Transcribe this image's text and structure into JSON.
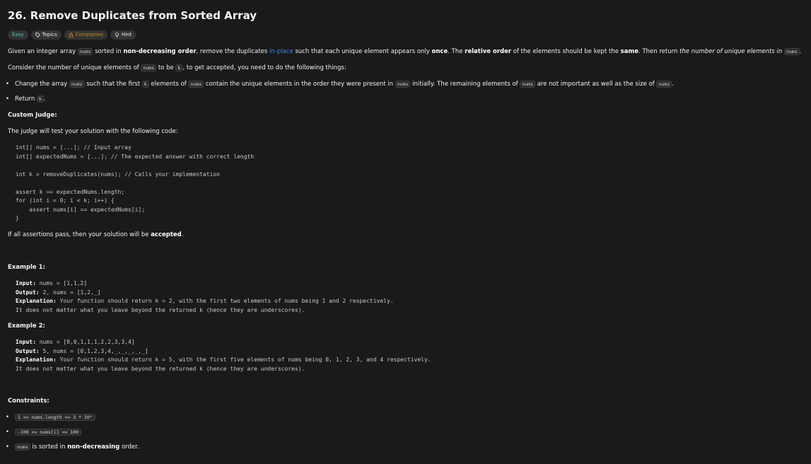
{
  "problem": {
    "title": "26. Remove Duplicates from Sorted Array",
    "tags": {
      "difficulty": "Easy",
      "topics": "Topics",
      "companies": "Companies",
      "hint": "Hint"
    }
  },
  "description": {
    "p1_a": "Given an integer array",
    "code_nums": "nums",
    "p1_b": "sorted in",
    "p1_c": "non-decreasing order",
    "p1_d": ", remove the duplicates",
    "p1_e": "in-place",
    "p1_f": "such that each unique element appears only",
    "p1_g": "once",
    "p1_h": ". The",
    "p1_i": "relative order",
    "p1_j": "of the elements should be kept the",
    "p1_k": "same",
    "p1_l": ". Then return",
    "p1_m": "the number of unique elements in",
    "p1_n": ".",
    "p2_a": "Consider the number of unique elements of",
    "p2_b": "to be",
    "code_k": "k",
    "p2_c": ", to get accepted, you need to do the following things:",
    "b1_a": "Change the array",
    "b1_b": "such that the first",
    "b1_c": "elements of",
    "b1_d": "contain the unique elements in the order they were present in",
    "b1_e": "initially. The remaining elements of",
    "b1_f": "are not important as well as the size of",
    "b1_g": ".",
    "b2_a": "Return",
    "b2_b": ".",
    "custom_judge": "Custom Judge:",
    "judge_intro": "The judge will test your solution with the following code:",
    "judge_code": [
      "int[] nums = [...]; // Input array",
      "int[] expectedNums = [...]; // The expected answer with correct length",
      "",
      "int k = removeDuplicates(nums); // Calls your implementation",
      "",
      "assert k == expectedNums.length;",
      "for (int i = 0; i < k; i++) {",
      "    assert nums[i] == expectedNums[i];",
      "}"
    ],
    "accepted_a": "If all assertions pass, then your solution will be",
    "accepted_b": "accepted",
    "accepted_c": "."
  },
  "examples": [
    {
      "heading": "Example 1:",
      "input_label": "Input:",
      "input": "nums = [1,1,2]",
      "output_label": "Output:",
      "output": "2, nums = [1,2,_]",
      "explanation_label": "Explanation:",
      "explanation_1": "Your function should return k = 2, with the first two elements of nums being 1 and 2 respectively.",
      "explanation_2": "It does not matter what you leave beyond the returned k (hence they are underscores)."
    },
    {
      "heading": "Example 2:",
      "input_label": "Input:",
      "input": "nums = [0,0,1,1,1,2,2,3,3,4]",
      "output_label": "Output:",
      "output": "5, nums = [0,1,2,3,4,_,_,_,_,_]",
      "explanation_label": "Explanation:",
      "explanation_1": "Your function should return k = 5, with the first five elements of nums being 0, 1, 2, 3, and 4 respectively.",
      "explanation_2": "It does not matter what you leave beyond the returned k (hence they are underscores)."
    }
  ],
  "constraints": {
    "heading": "Constraints:",
    "c1": "1 <= nums.length <= 3 * 10⁴",
    "c2": "-100 <= nums[i] <= 100",
    "c3_code": "nums",
    "c3_a": "is sorted in",
    "c3_b": "non-decreasing",
    "c3_c": "order."
  },
  "colors": {
    "background": "#1a1a1a",
    "easy": "#46c6c2",
    "companies": "#c48a1a",
    "link": "#3b82f6"
  }
}
